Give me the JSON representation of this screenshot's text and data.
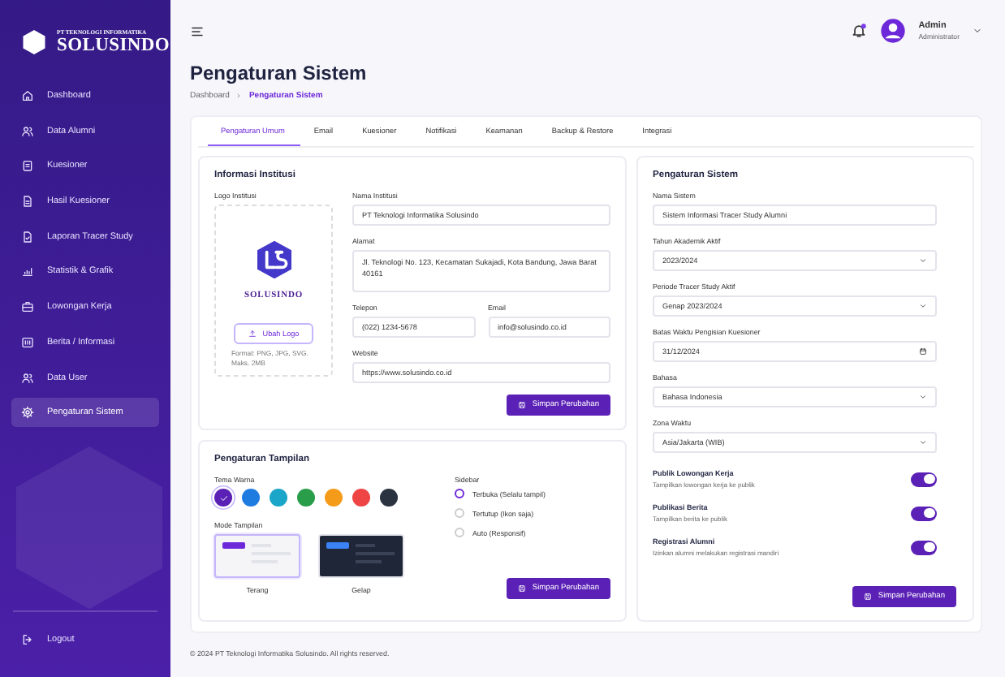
{
  "sidebar": {
    "company": "PT TEKNOLOGI INFORMATIKA",
    "brand": "SOLUSINDO",
    "items": [
      {
        "label": "Dashboard",
        "selected": false
      },
      {
        "label": "Data Alumni",
        "selected": false
      },
      {
        "label": "Kuesioner",
        "selected": false
      },
      {
        "label": "Hasil Kuesioner",
        "selected": false
      },
      {
        "label": "Laporan Tracer Study",
        "selected": false
      },
      {
        "label": "Statistik & Grafik",
        "selected": false
      },
      {
        "label": "Lowongan Kerja",
        "selected": false
      },
      {
        "label": "Berita / Informasi",
        "selected": false
      },
      {
        "label": "Data User",
        "selected": false
      },
      {
        "label": "Pengaturan Sistem",
        "selected": true
      }
    ],
    "logout": "Logout"
  },
  "topbar": {
    "user": {
      "name": "Admin",
      "role": "Administrator"
    }
  },
  "page": {
    "title": "Pengaturan Sistem",
    "breadcrumb": [
      "Dashboard",
      "Pengaturan Sistem"
    ]
  },
  "tabs": [
    {
      "label": "Pengaturan Umum",
      "selected": true
    },
    {
      "label": "Email",
      "selected": false
    },
    {
      "label": "Kuesioner",
      "selected": false
    },
    {
      "label": "Notifikasi",
      "selected": false
    },
    {
      "label": "Keamanan",
      "selected": false
    },
    {
      "label": "Backup & Restore",
      "selected": false
    },
    {
      "label": "Integrasi",
      "selected": false
    }
  ],
  "institution": {
    "title": "Informasi Institusi",
    "logo_label": "Logo Institusi",
    "logo_text": "SOLUSINDO",
    "upload_button": "Ubah Logo",
    "logo_hint": "Format: PNG, JPG, SVG. Maks. 2MB",
    "fields": [
      {
        "label": "Nama Institusi",
        "kind": "text",
        "value": "PT Teknologi Informatika Solusindo"
      },
      {
        "label": "Alamat",
        "kind": "textarea",
        "value": "Jl. Teknologi No. 123, Kecamatan Sukajadi, Kota Bandung, Jawa Barat 40161"
      },
      {
        "label": "Telepon",
        "kind": "text",
        "value": "(022) 1234-5678"
      },
      {
        "label": "Email",
        "kind": "text",
        "value": "info@solusindo.co.id"
      },
      {
        "label": "Website",
        "kind": "text",
        "value": "https://www.solusindo.co.id"
      }
    ],
    "save_button": "Simpan Perubahan"
  },
  "display": {
    "title": "Pengaturan Tampilan",
    "colors_label": "Tema Warna",
    "colors": [
      {
        "color": "#5b21b6",
        "selected": true
      },
      {
        "color": "#1e7be0",
        "selected": false
      },
      {
        "color": "#1aa6c8",
        "selected": false
      },
      {
        "color": "#2a9d4b",
        "selected": false
      },
      {
        "color": "#f59b1a",
        "selected": false
      },
      {
        "color": "#ef4444",
        "selected": false
      },
      {
        "color": "#2b3240",
        "selected": false
      }
    ],
    "mode_label": "Mode Tampilan",
    "modes": [
      {
        "label": "Terang",
        "kind": "light",
        "selected": true
      },
      {
        "label": "Gelap",
        "kind": "dark",
        "selected": false
      }
    ],
    "sidebar_label": "Sidebar",
    "sidebar_options": [
      {
        "label": "Terbuka (Selalu tampil)",
        "selected": true
      },
      {
        "label": "Tertutup (Ikon saja)",
        "selected": false
      },
      {
        "label": "Auto (Responsif)",
        "selected": false
      }
    ],
    "save_button": "Simpan Perubahan"
  },
  "system": {
    "title": "Pengaturan Sistem",
    "fields": [
      {
        "label": "Nama Sistem",
        "kind": "text",
        "value": "Sistem Informasi Tracer Study Alumni"
      },
      {
        "label": "Tahun Akademik Aktif",
        "kind": "select",
        "value": "2023/2024"
      },
      {
        "label": "Periode Tracer Study Aktif",
        "kind": "select",
        "value": "Genap 2023/2024"
      },
      {
        "label": "Batas Waktu Pengisian Kuesioner",
        "kind": "date",
        "value": "31/12/2024"
      },
      {
        "label": "Bahasa",
        "kind": "select",
        "value": "Bahasa Indonesia"
      },
      {
        "label": "Zona Waktu",
        "kind": "select",
        "value": "Asia/Jakarta (WIB)"
      }
    ],
    "toggles": [
      {
        "title": "Publik Lowongan Kerja",
        "description": "Tampilkan lowongan kerja ke publik",
        "on": true
      },
      {
        "title": "Publikasi Berita",
        "description": "Tampilkan berita ke publik",
        "on": true
      },
      {
        "title": "Registrasi Alumni",
        "description": "Izinkan alumni melakukan registrasi mandiri",
        "on": true
      }
    ],
    "save_button": "Simpan Perubahan"
  },
  "footer": "© 2024 PT Teknologi Informatika Solusindo. All rights reserved."
}
